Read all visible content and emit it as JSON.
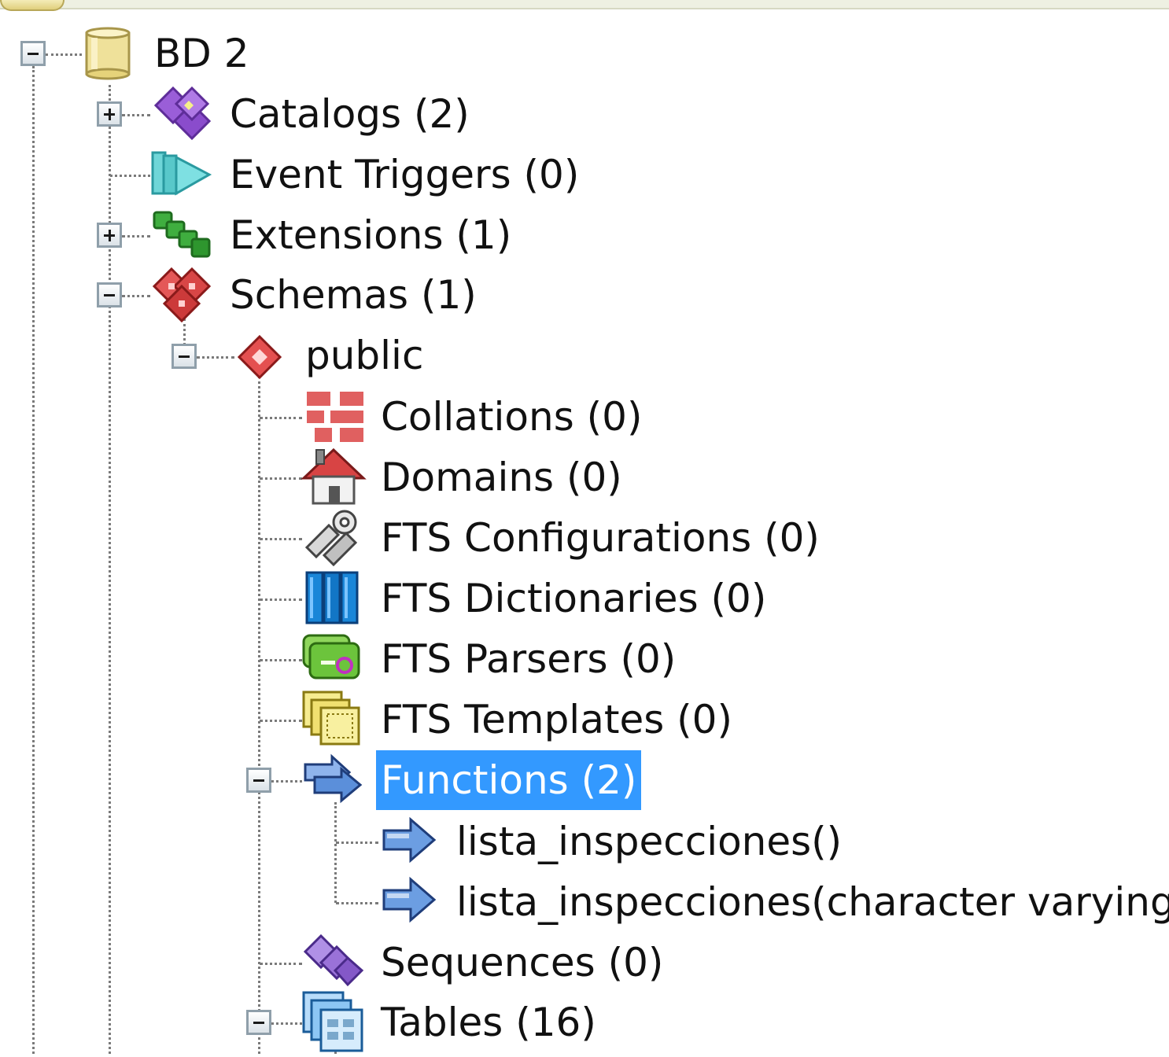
{
  "tree": {
    "database": {
      "label": "BD 2",
      "icon": "database-icon"
    },
    "catalogs": {
      "label": "Catalogs (2)",
      "icon": "catalogs-icon"
    },
    "event_triggers": {
      "label": "Event Triggers (0)",
      "icon": "event-triggers-icon"
    },
    "extensions": {
      "label": "Extensions (1)",
      "icon": "extensions-icon"
    },
    "schemas": {
      "label": "Schemas (1)",
      "icon": "schemas-icon"
    },
    "public": {
      "label": "public",
      "icon": "schema-icon"
    },
    "collations": {
      "label": "Collations (0)",
      "icon": "collations-icon"
    },
    "domains": {
      "label": "Domains (0)",
      "icon": "domains-icon"
    },
    "fts_configurations": {
      "label": "FTS Configurations (0)",
      "icon": "fts-configurations-icon"
    },
    "fts_dictionaries": {
      "label": "FTS Dictionaries (0)",
      "icon": "fts-dictionaries-icon"
    },
    "fts_parsers": {
      "label": "FTS Parsers (0)",
      "icon": "fts-parsers-icon"
    },
    "fts_templates": {
      "label": "FTS Templates (0)",
      "icon": "fts-templates-icon"
    },
    "functions": {
      "label": "Functions (2)",
      "icon": "functions-icon",
      "selected": true
    },
    "function_1": {
      "label": "lista_inspecciones()",
      "icon": "function-icon"
    },
    "function_2": {
      "label": "lista_inspecciones(character varying)",
      "icon": "function-icon"
    },
    "sequences": {
      "label": "Sequences (0)",
      "icon": "sequences-icon"
    },
    "tables": {
      "label": "Tables (16)",
      "icon": "tables-icon"
    }
  },
  "colors": {
    "selection": "#3399ff",
    "tree_line": "#7a7a7a"
  }
}
